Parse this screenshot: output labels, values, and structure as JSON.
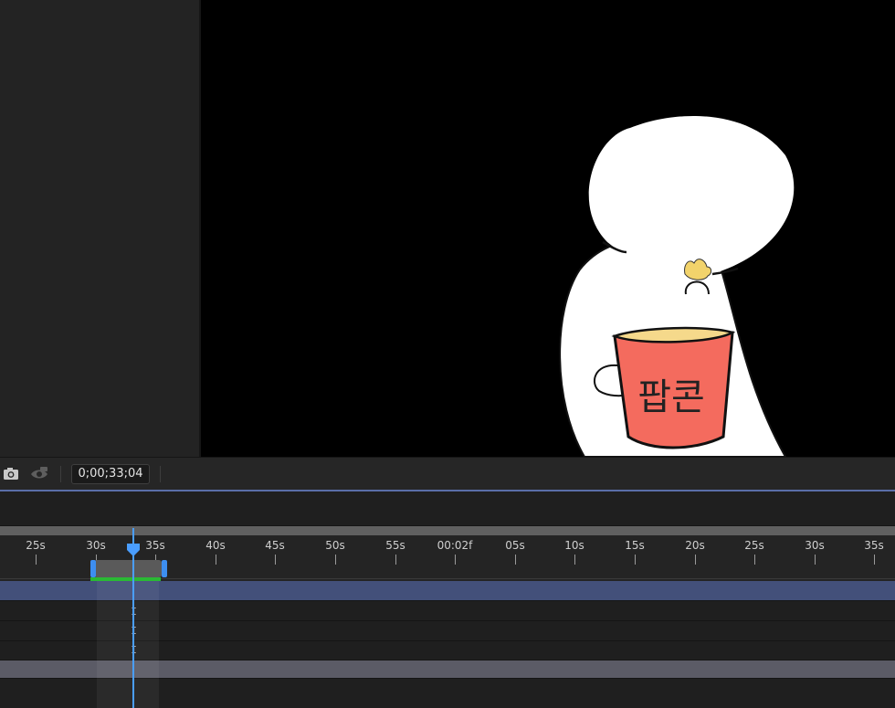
{
  "viewer": {
    "popcorn_cup_label": "팝콘",
    "background_color": "#000000"
  },
  "toolbar": {
    "camera_icon": "camera-icon",
    "show_snapshot_icon": "eye-snapshot-icon",
    "timecode": "0;00;33;04"
  },
  "timeline": {
    "ruler_labels": [
      "25s",
      "30s",
      "35s",
      "40s",
      "45s",
      "50s",
      "55s",
      "00:02f",
      "05s",
      "10s",
      "15s",
      "20s",
      "25s",
      "30s",
      "35s"
    ],
    "colors": {
      "playhead": "#4a9eff",
      "work_area_handles": "#3d8ef0",
      "render_bar": "#2ab934",
      "selected_layer": "#43507a",
      "second_layer": "#5b5b66"
    },
    "keyframe_glyph": "I"
  }
}
